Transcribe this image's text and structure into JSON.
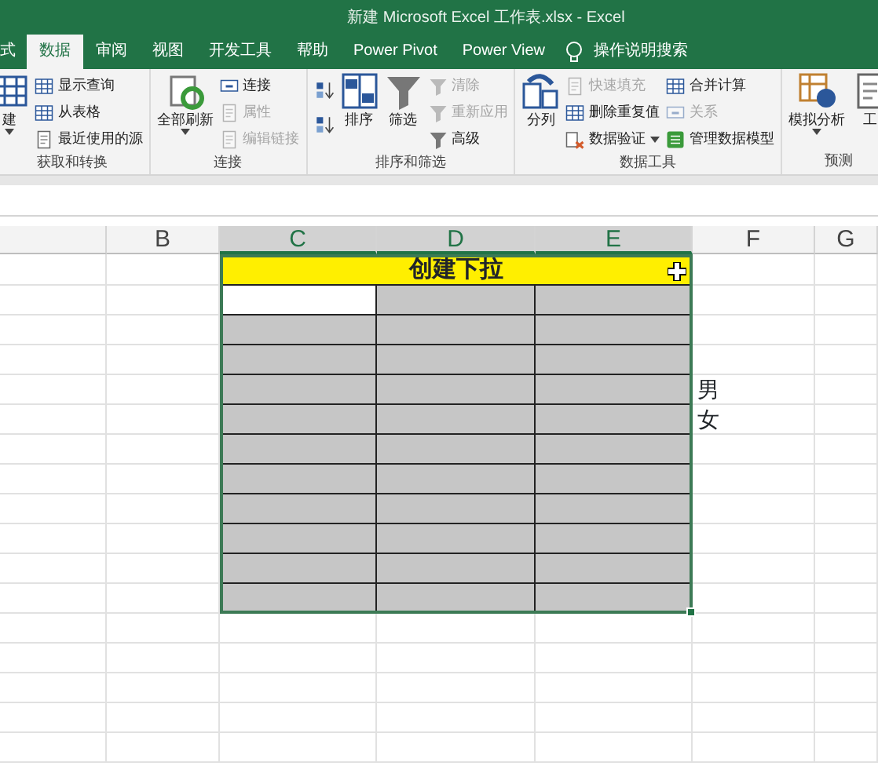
{
  "window": {
    "title": "新建 Microsoft Excel 工作表.xlsx  -  Excel"
  },
  "tabs": [
    {
      "label": "式",
      "selected": false
    },
    {
      "label": "数据",
      "selected": true
    },
    {
      "label": "审阅",
      "selected": false
    },
    {
      "label": "视图",
      "selected": false
    },
    {
      "label": "开发工具",
      "selected": false
    },
    {
      "label": "帮助",
      "selected": false
    },
    {
      "label": "Power Pivot",
      "selected": false
    },
    {
      "label": "Power View",
      "selected": false
    }
  ],
  "tell_me": {
    "label": "操作说明搜索"
  },
  "ribbon": {
    "groups": [
      {
        "label": "获取和转换",
        "columns": [
          {
            "kind": "large",
            "label": "建",
            "dropdown": true
          },
          {
            "kind": "stack",
            "items": [
              {
                "label": "显示查询",
                "disabled": false
              },
              {
                "label": "从表格",
                "disabled": false
              },
              {
                "label": "最近使用的源",
                "disabled": false
              }
            ]
          }
        ]
      },
      {
        "label": "连接",
        "columns": [
          {
            "kind": "large",
            "label": "全部刷新",
            "dropdown": true
          },
          {
            "kind": "stack",
            "items": [
              {
                "label": "连接",
                "disabled": false
              },
              {
                "label": "属性",
                "disabled": true
              },
              {
                "label": "编辑链接",
                "disabled": true
              }
            ]
          }
        ]
      },
      {
        "label": "排序和筛选",
        "columns": [
          {
            "kind": "icons"
          },
          {
            "kind": "large",
            "label": "排序"
          },
          {
            "kind": "large",
            "label": "筛选"
          },
          {
            "kind": "stack",
            "items": [
              {
                "label": "清除",
                "disabled": true
              },
              {
                "label": "重新应用",
                "disabled": true
              },
              {
                "label": "高级",
                "disabled": false
              }
            ]
          }
        ]
      },
      {
        "label": "数据工具",
        "columns": [
          {
            "kind": "large",
            "label": "分列"
          },
          {
            "kind": "stack",
            "items": [
              {
                "label": "快速填充",
                "disabled": true
              },
              {
                "label": "删除重复值",
                "disabled": false
              },
              {
                "label": "数据验证",
                "disabled": false,
                "dropdown": true
              }
            ]
          },
          {
            "kind": "stack",
            "items": [
              {
                "label": "合并计算",
                "disabled": false
              },
              {
                "label": "关系",
                "disabled": true
              },
              {
                "label": "管理数据模型",
                "disabled": false
              }
            ]
          }
        ]
      },
      {
        "label": "预测",
        "columns": [
          {
            "kind": "large",
            "label": "模拟分析",
            "dropdown": true
          },
          {
            "kind": "large",
            "label": "工"
          }
        ]
      }
    ]
  },
  "sheet": {
    "columns": [
      {
        "label": "B",
        "selected": false
      },
      {
        "label": "C",
        "selected": true
      },
      {
        "label": "D",
        "selected": true
      },
      {
        "label": "E",
        "selected": true
      },
      {
        "label": "F",
        "selected": false
      },
      {
        "label": "G",
        "selected": false
      }
    ],
    "title_row": {
      "text": "创建下拉"
    },
    "rows": [
      {
        "selected": true,
        "active": true
      },
      {
        "selected": true,
        "active": false
      },
      {
        "selected": true,
        "active": false
      },
      {
        "selected": true,
        "active": false,
        "column_f": "男"
      },
      {
        "selected": true,
        "active": false,
        "column_f": "女"
      },
      {
        "selected": true,
        "active": false
      },
      {
        "selected": true,
        "active": false
      },
      {
        "selected": true,
        "active": false
      },
      {
        "selected": true,
        "active": false
      },
      {
        "selected": true,
        "active": false
      },
      {
        "selected": true,
        "active": false
      },
      {
        "selected": false,
        "active": false
      },
      {
        "selected": false,
        "active": false
      },
      {
        "selected": false,
        "active": false
      },
      {
        "selected": false,
        "active": false
      },
      {
        "selected": false,
        "active": false
      }
    ]
  }
}
